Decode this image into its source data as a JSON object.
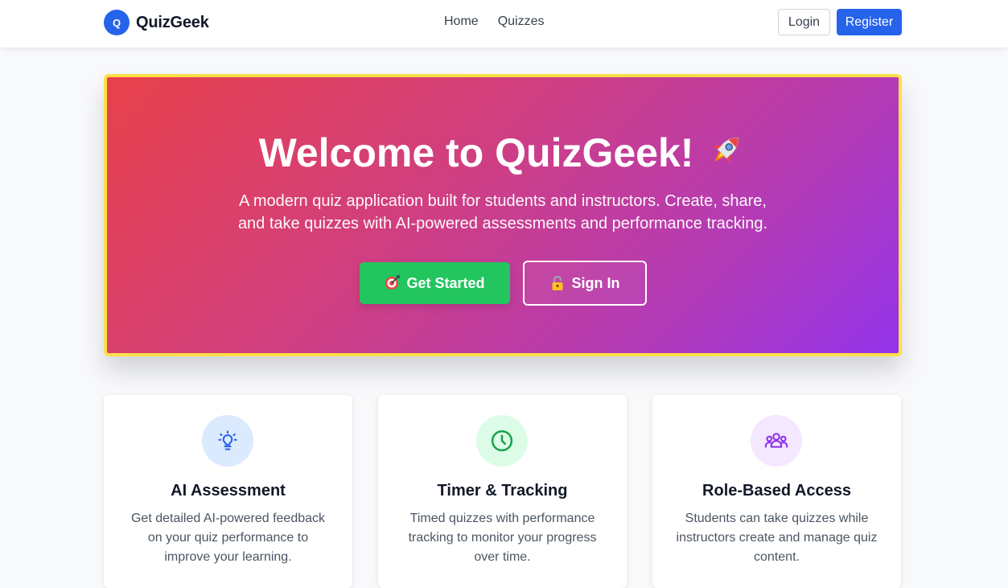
{
  "nav": {
    "logo_letter": "Q",
    "brand": "QuizGeek",
    "links": [
      "Home",
      "Quizzes"
    ],
    "login": "Login",
    "register": "Register"
  },
  "hero": {
    "title": "Welcome to QuizGeek!",
    "title_icon": "rocket-icon",
    "subtitle": "A modern quiz application built for students and instructors. Create, share, and take quizzes with AI-powered assessments and performance tracking.",
    "primary_button": "Get Started",
    "primary_button_icon": "target-icon",
    "secondary_button": "Sign In",
    "secondary_button_icon": "lock-icon"
  },
  "features": [
    {
      "title": "AI Assessment",
      "text": "Get detailed AI-powered feedback on your quiz performance to improve your learning.",
      "icon": "lightbulb-icon",
      "icon_color": "#2563eb",
      "icon_bg": "#dbeafe"
    },
    {
      "title": "Timer & Tracking",
      "text": "Timed quizzes with performance tracking to monitor your progress over time.",
      "icon": "clock-icon",
      "icon_color": "#16a34a",
      "icon_bg": "#dcfce7"
    },
    {
      "title": "Role-Based Access",
      "text": "Students can take quizzes while instructors create and manage quiz content.",
      "icon": "users-icon",
      "icon_color": "#9333ea",
      "icon_bg": "#f3e8ff"
    }
  ],
  "colors": {
    "primary": "#2563eb",
    "success": "#22c55e",
    "hero_border": "#fde047"
  }
}
